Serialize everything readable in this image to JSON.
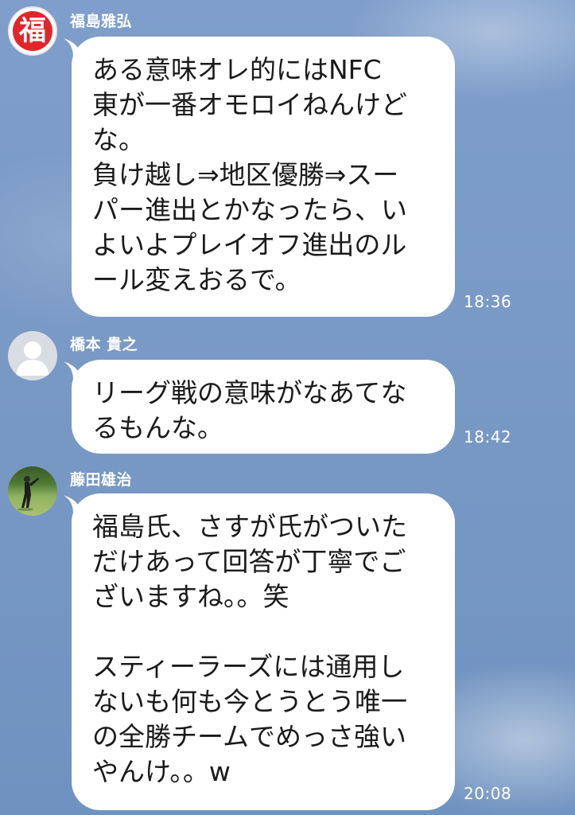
{
  "messages": [
    {
      "sender": "福島雅弘",
      "avatar": {
        "type": "logo",
        "glyph": "福",
        "color": "#e0262b"
      },
      "text": "ある意味オレ的にはNFC\n東が一番オモロイねんけど\nな。\n負け越し⇒地区優勝⇒スー\nパー進出とかなったら、い\nよいよプレイオフ進出のル\nール変えおるで。",
      "time": "18:36"
    },
    {
      "sender": "橋本 貴之",
      "avatar": {
        "type": "default-user-icon"
      },
      "text": "リーグ戦の意味がなあてな\nるもんな。",
      "time": "18:42"
    },
    {
      "sender": "藤田雄治",
      "avatar": {
        "type": "photo"
      },
      "text": "福島氏、さすが氏がついた\nだけあって回答が丁寧でご\nざいますね。。笑\n\nスティーラーズには通用し\nないも何も今とうとう唯一\nの全勝チームでめっさ強い\nやんけ。。w",
      "time": "20:08"
    }
  ],
  "colors": {
    "background": "#7b9cc7",
    "bubble": "#ffffff",
    "text": "#1a1a1a",
    "meta": "#ffffff"
  }
}
